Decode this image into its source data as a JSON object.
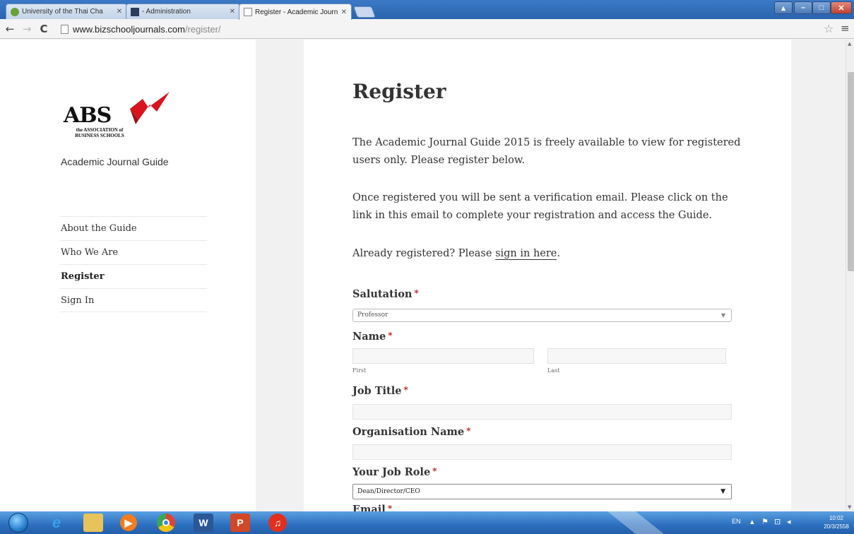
{
  "browser": {
    "tabs": [
      {
        "title": "University of the Thai Cha",
        "active": false
      },
      {
        "title": "- Administration",
        "active": false
      },
      {
        "title": "Register - Academic Journ",
        "active": true
      }
    ],
    "address": {
      "host": "www.bizschooljournals.com",
      "path": "/register/"
    }
  },
  "site": {
    "logo_text": "ABS",
    "logo_sub_line1": "the ASSOCIATION of",
    "logo_sub_line2": "BUSINESS SCHOOLS",
    "description": "Academic Journal Guide",
    "nav": [
      {
        "label": "About the Guide",
        "current": false
      },
      {
        "label": "Who We Are",
        "current": false
      },
      {
        "label": "Register",
        "current": true
      },
      {
        "label": "Sign In",
        "current": false
      }
    ]
  },
  "page": {
    "title": "Register",
    "intro": "The Academic Journal Guide 2015 is freely available to view for registered users only. Please register below.",
    "verification": "Once registered you will be sent a verification email. Please click on the link in this email to complete your registration and access the Guide.",
    "already_prefix": "Already registered? Please ",
    "already_link": "sign in here",
    "already_suffix": "."
  },
  "form": {
    "required_mark": "*",
    "salutation": {
      "label": "Salutation",
      "value": "Professor"
    },
    "name": {
      "label": "Name",
      "first_label": "First",
      "last_label": "Last"
    },
    "job_title": {
      "label": "Job Title"
    },
    "organisation": {
      "label": "Organisation Name"
    },
    "job_role": {
      "label": "Your Job Role",
      "value": "Dean/Director/CEO"
    },
    "email": {
      "label": "Email"
    }
  },
  "taskbar": {
    "lang": "EN",
    "time": "10:02",
    "date": "20/3/2558"
  },
  "colors": {
    "required": "#b01e1e",
    "taskbar": "#2c6fbf",
    "titlebar": "#3b79c7"
  }
}
